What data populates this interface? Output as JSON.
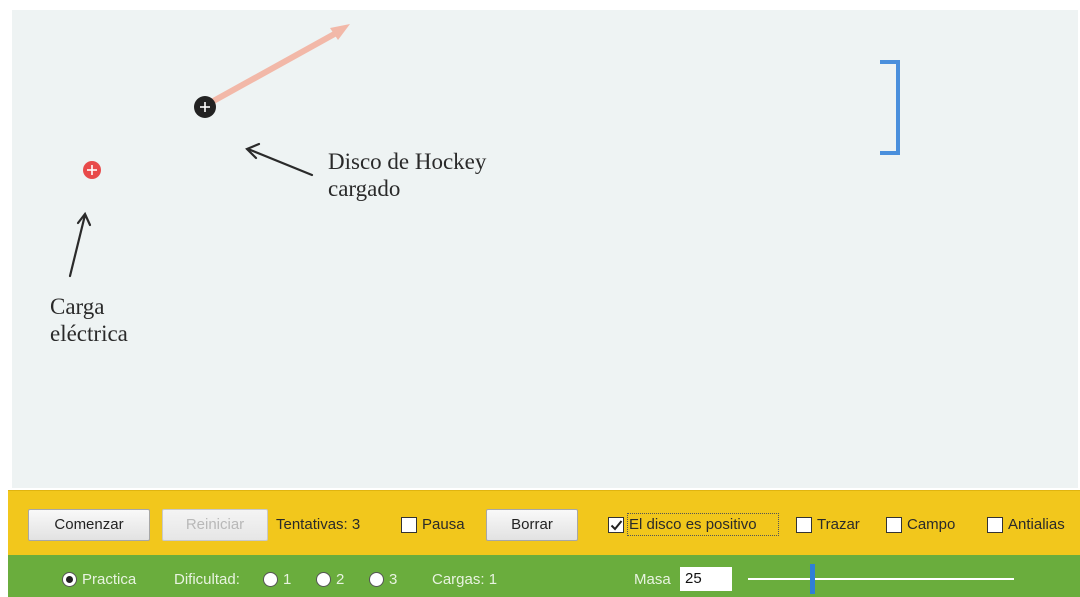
{
  "playfield": {
    "annotations": {
      "puck_label": "Disco de Hockey\ncargado",
      "charge_label": "Carga\neléctrica"
    },
    "puck": {
      "sign": "+",
      "color": "#222222"
    },
    "charge": {
      "sign": "+",
      "color": "#e84a4a"
    },
    "velocity_arrow_color": "#f2b8a8",
    "goal_color": "#4a8fdc"
  },
  "toolbar": {
    "start_label": "Comenzar",
    "restart_label": "Reiniciar",
    "attempts_text": "Tentativas: 3",
    "pause_label": "Pausa",
    "clear_label": "Borrar",
    "positive_puck_label": "El disco es positivo",
    "trace_label": "Trazar",
    "field_label": "Campo",
    "antialias_label": "Antialias",
    "background_color": "#f2c71c"
  },
  "statusbar": {
    "practice_label": "Practica",
    "difficulty_label": "Dificultad:",
    "difficulty_options": [
      "1",
      "2",
      "3"
    ],
    "charges_text": "Cargas: 1",
    "mass_label": "Masa",
    "mass_value": "25",
    "background_color": "#6aad3d"
  }
}
